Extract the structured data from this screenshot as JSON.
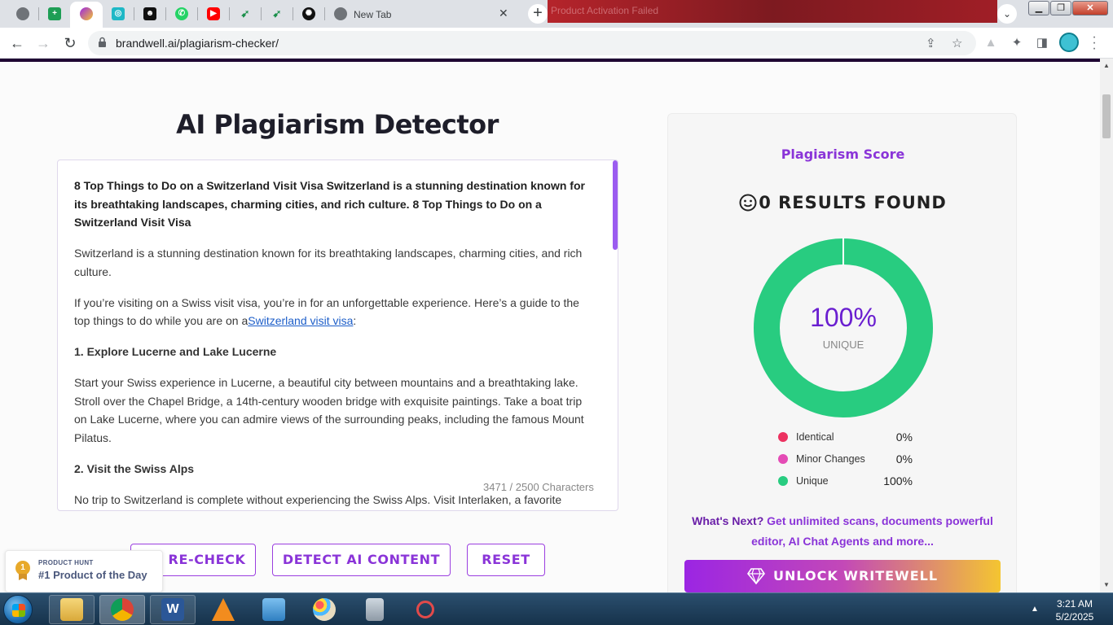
{
  "browser": {
    "tabs": [
      {
        "icon": "chrome-gray-icon"
      },
      {
        "icon": "google-sheets-icon"
      },
      {
        "icon": "brandwell-icon",
        "active": true
      },
      {
        "icon": "openai-icon"
      },
      {
        "icon": "bot-icon"
      },
      {
        "icon": "whatsapp-icon"
      },
      {
        "icon": "youtube-icon"
      },
      {
        "icon": "airline-icon"
      },
      {
        "icon": "airline-icon"
      },
      {
        "icon": "chatgpt-icon"
      }
    ],
    "new_tab_title": "New Tab",
    "url": "brandwell.ai/plagiarism-checker/",
    "ext_strip_text": "Product Activation Failed"
  },
  "page": {
    "title": "AI Plagiarism Detector",
    "editor": {
      "lead": "8 Top Things to Do on a Switzerland Visit Visa Switzerland is a stunning destination known for its breathtaking landscapes, charming cities, and rich culture. 8 Top Things to Do on a Switzerland Visit Visa",
      "p1": "Switzerland is a stunning destination known for its breathtaking landscapes, charming cities, and rich culture.",
      "p2_before": "If you’re visiting on a Swiss visit visa, you’re in for an unforgettable experience. Here’s a guide to the top things to do while you are on a",
      "p2_link": "Switzerland visit visa",
      "p2_after": ":",
      "h1": "1. Explore Lucerne and Lake Lucerne",
      "p3": "Start your Swiss experience in Lucerne, a beautiful city between mountains and a breathtaking lake. Stroll over the Chapel Bridge, a 14th-century wooden bridge with exquisite paintings.  Take a boat trip on Lake Lucerne, where you can admire views of the surrounding peaks, including the famous Mount Pilatus.",
      "h2": "2. Visit the Swiss Alps",
      "p4": "No trip to Switzerland is complete without experiencing the Swiss Alps. Visit Interlaken, a favorite",
      "char_count": "3471 / 2500 Characters"
    },
    "buttons": {
      "recheck": "RE-CHECK",
      "detect_ai": "DETECT AI CONTENT",
      "reset": "RESET"
    },
    "product_hunt": {
      "small": "PRODUCT HUNT",
      "big": "#1 Product of the Day",
      "medal": "1"
    }
  },
  "score": {
    "label": "Plagiarism Score",
    "results": "0 RESULTS FOUND",
    "percent": "100%",
    "percent_label": "UNIQUE",
    "unique_fraction": 1.0,
    "legend": [
      {
        "name": "Identical",
        "value": "0%",
        "color": "#ec3160"
      },
      {
        "name": "Minor Changes",
        "value": "0%",
        "color": "#e44bb5"
      },
      {
        "name": "Unique",
        "value": "100%",
        "color": "#28cc80"
      }
    ],
    "whats_next_strong": "What's Next?",
    "whats_next": "Get unlimited scans, documents powerful editor, AI Chat Agents and more...",
    "unlock": "UNLOCK WRITEWELL"
  },
  "taskbar": {
    "items": [
      {
        "icon": "file-explorer-icon"
      },
      {
        "icon": "chrome-icon",
        "active": true
      },
      {
        "icon": "word-icon"
      },
      {
        "icon": "vlc-icon"
      },
      {
        "icon": "control-panel-icon"
      },
      {
        "icon": "paint-icon"
      },
      {
        "icon": "calculator-icon"
      },
      {
        "icon": "snipping-tool-icon"
      }
    ],
    "time": "3:21 AM",
    "date": "5/2/2025"
  },
  "colors": {
    "accent": "#8a34d8",
    "unique_green": "#28cc80",
    "title_dark": "#1e1e2a"
  }
}
